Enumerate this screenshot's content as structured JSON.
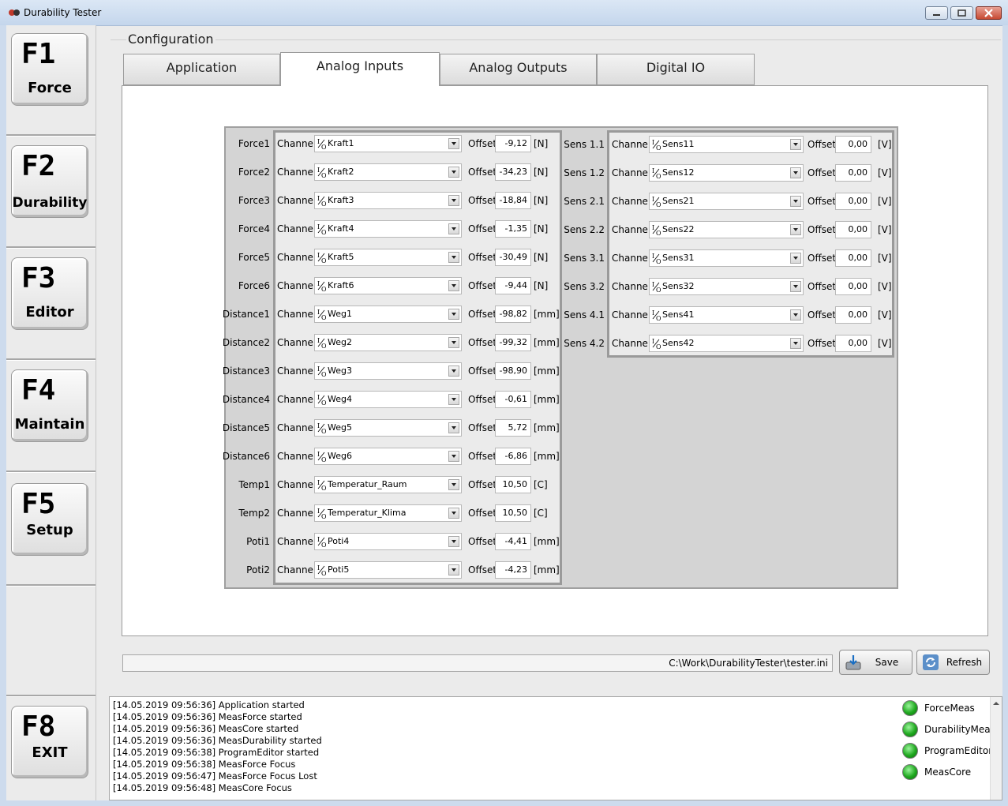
{
  "window": {
    "title": "Durability Tester"
  },
  "sidebar": {
    "keys": [
      {
        "key": "F1",
        "label": "Force"
      },
      {
        "key": "F2",
        "label": "Durability"
      },
      {
        "key": "F3",
        "label": "Editor"
      },
      {
        "key": "F4",
        "label": "Maintain"
      },
      {
        "key": "F5",
        "label": "Setup"
      },
      {
        "key": "F8",
        "label": "EXIT"
      }
    ]
  },
  "config": {
    "legend": "Configuration",
    "tabs": [
      "Application",
      "Analog Inputs",
      "Analog Outputs",
      "Digital IO"
    ],
    "active_tab": "Analog Inputs",
    "channel_label": "Channel",
    "offset_label": "Offset",
    "left_rows": [
      {
        "name": "Force1",
        "channel": "Kraft1",
        "offset": "-9,12",
        "unit": "[N]"
      },
      {
        "name": "Force2",
        "channel": "Kraft2",
        "offset": "-34,23",
        "unit": "[N]"
      },
      {
        "name": "Force3",
        "channel": "Kraft3",
        "offset": "-18,84",
        "unit": "[N]"
      },
      {
        "name": "Force4",
        "channel": "Kraft4",
        "offset": "-1,35",
        "unit": "[N]"
      },
      {
        "name": "Force5",
        "channel": "Kraft5",
        "offset": "-30,49",
        "unit": "[N]"
      },
      {
        "name": "Force6",
        "channel": "Kraft6",
        "offset": "-9,44",
        "unit": "[N]"
      },
      {
        "name": "Distance1",
        "channel": "Weg1",
        "offset": "-98,82",
        "unit": "[mm]"
      },
      {
        "name": "Distance2",
        "channel": "Weg2",
        "offset": "-99,32",
        "unit": "[mm]"
      },
      {
        "name": "Distance3",
        "channel": "Weg3",
        "offset": "-98,90",
        "unit": "[mm]"
      },
      {
        "name": "Distance4",
        "channel": "Weg4",
        "offset": "-0,61",
        "unit": "[mm]"
      },
      {
        "name": "Distance5",
        "channel": "Weg5",
        "offset": "5,72",
        "unit": "[mm]"
      },
      {
        "name": "Distance6",
        "channel": "Weg6",
        "offset": "-6,86",
        "unit": "[mm]"
      },
      {
        "name": "Temp1",
        "channel": "Temperatur_Raum",
        "offset": "10,50",
        "unit": "[C]"
      },
      {
        "name": "Temp2",
        "channel": "Temperatur_Klima",
        "offset": "10,50",
        "unit": "[C]"
      },
      {
        "name": "Poti1",
        "channel": "Poti4",
        "offset": "-4,41",
        "unit": "[mm]"
      },
      {
        "name": "Poti2",
        "channel": "Poti5",
        "offset": "-4,23",
        "unit": "[mm]"
      }
    ],
    "right_rows": [
      {
        "name": "Sens 1.1",
        "channel": "Sens11",
        "offset": "0,00",
        "unit": "[V]"
      },
      {
        "name": "Sens 1.2",
        "channel": "Sens12",
        "offset": "0,00",
        "unit": "[V]"
      },
      {
        "name": "Sens 2.1",
        "channel": "Sens21",
        "offset": "0,00",
        "unit": "[V]"
      },
      {
        "name": "Sens 2.2",
        "channel": "Sens22",
        "offset": "0,00",
        "unit": "[V]"
      },
      {
        "name": "Sens 3.1",
        "channel": "Sens31",
        "offset": "0,00",
        "unit": "[V]"
      },
      {
        "name": "Sens 3.2",
        "channel": "Sens32",
        "offset": "0,00",
        "unit": "[V]"
      },
      {
        "name": "Sens 4.1",
        "channel": "Sens41",
        "offset": "0,00",
        "unit": "[V]"
      },
      {
        "name": "Sens 4.2",
        "channel": "Sens42",
        "offset": "0,00",
        "unit": "[V]"
      }
    ]
  },
  "footer": {
    "path": "C:\\Work\\DurabilityTester\\tester.ini",
    "save_label": "Save",
    "refresh_label": "Refresh"
  },
  "log": {
    "lines": [
      "[14.05.2019 09:56:36] Application started",
      "[14.05.2019 09:56:36] MeasForce started",
      "[14.05.2019 09:56:36] MeasCore started",
      "[14.05.2019 09:56:36] MeasDurability started",
      "[14.05.2019 09:56:38] ProgramEditor started",
      "[14.05.2019 09:56:38] MeasForce Focus",
      "[14.05.2019 09:56:47] MeasForce Focus Lost",
      "[14.05.2019 09:56:48] MeasCore Focus"
    ],
    "status": [
      {
        "label": "ForceMeas",
        "color": "#1fa81f"
      },
      {
        "label": "DurabilityMeas",
        "color": "#1fa81f"
      },
      {
        "label": "ProgramEditor",
        "color": "#1fa81f"
      },
      {
        "label": "MeasCore",
        "color": "#1fa81f"
      }
    ]
  }
}
